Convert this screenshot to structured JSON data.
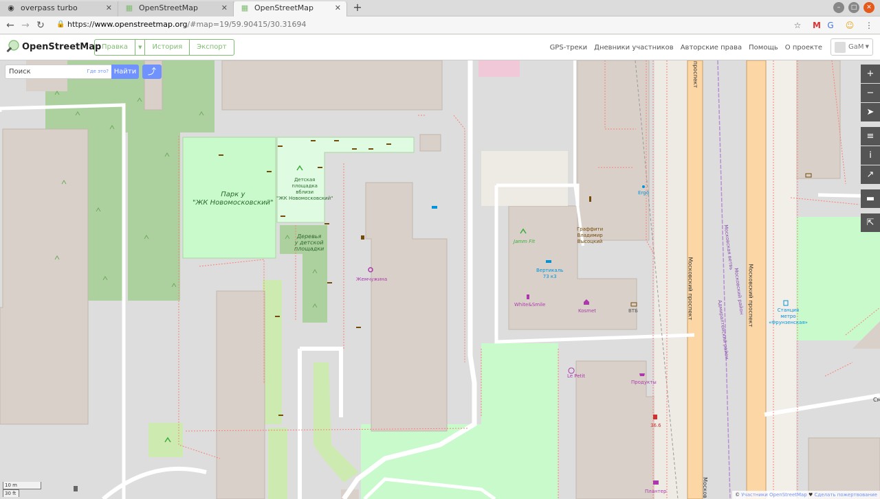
{
  "browser": {
    "tabs": [
      {
        "title": "overpass turbo",
        "icon": "overpass-icon"
      },
      {
        "title": "OpenStreetMap",
        "icon": "osm-icon"
      },
      {
        "title": "OpenStreetMap",
        "icon": "osm-icon",
        "active": true
      }
    ],
    "url_prefix": "https://",
    "url_host": "www.openstreetmap.org",
    "url_path": "/#map=19/59.90415/30.31694"
  },
  "osm": {
    "brand": "OpenStreetMap",
    "edit": "Правка",
    "history": "История",
    "export": "Экспорт",
    "links": [
      "GPS-треки",
      "Дневники участников",
      "Авторские права",
      "Помощь",
      "О проекте"
    ],
    "user": "GaM"
  },
  "search": {
    "placeholder": "Поиск",
    "where": "Где это?",
    "find": "Найти"
  },
  "controls": [
    "+",
    "−",
    "➤",
    "≡",
    "i",
    "↗",
    "▬",
    "⇱"
  ],
  "scale": {
    "metric": "10 m",
    "imperial": "30 ft"
  },
  "attribution": {
    "prefix": "© ",
    "contributors": "Участники OpenStreetMap",
    "heart": " ♥ ",
    "donate": "Сделать пожертвование"
  },
  "map_labels": {
    "park": "Парк у\n\"ЖК Новомосковский\"",
    "playground": "Детская\nплощадка\nвблизи\n\"ЖК Новомосковский\"",
    "trees": "Деревья\nу детской\nплощадки",
    "zhemchuzhina": "Жемчужина",
    "jamm": "Jamm Fit",
    "vertikal": "Вертикаль\n73 к3",
    "whitesmile": "White&Smile",
    "kosmet": "Kosmet",
    "vtb": "ВТБ",
    "graffiti": "Граффити\nВладимир\nВысоцкий",
    "ergo": "Ergo",
    "metro": "Станция\nметро\n«Фрунзенская»",
    "lepetit": "Le Petit",
    "produkty": "Продукты",
    "pharmacy": "36.6",
    "planter": "Плантер",
    "moskovsky1": "Московский проспект",
    "moskovsky2": "Московский проспект",
    "rail1": "Московская ветвь",
    "rail2": "Адмиралтейский район",
    "rail3": "Московский район",
    "street_sm": "См",
    "moskovsky3": "Москов",
    "moskovsky_top": "проспект"
  }
}
